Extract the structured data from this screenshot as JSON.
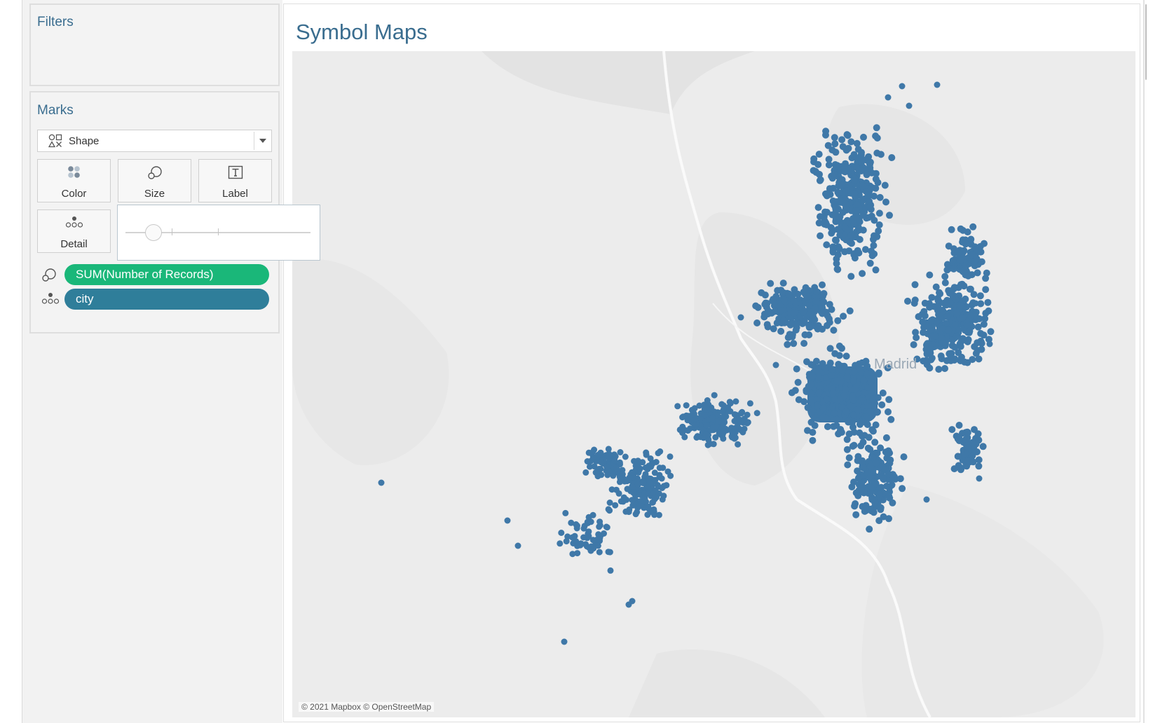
{
  "sidebar": {
    "filters_title": "Filters",
    "marks_title": "Marks",
    "mark_type": {
      "label": "Shape",
      "icon": "shape-icon"
    },
    "buttons": {
      "color": {
        "label": "Color",
        "icon": "color-dots-icon"
      },
      "size": {
        "label": "Size",
        "icon": "size-circles-icon"
      },
      "label": {
        "label": "Label",
        "icon": "text-label-icon"
      },
      "detail": {
        "label": "Detail",
        "icon": "detail-dots-icon"
      }
    },
    "size_slider": {
      "value": 0.15
    },
    "pills": [
      {
        "text": "SUM(Number of Records)",
        "icon": "size-circles-icon",
        "color": "#1ab779"
      },
      {
        "text": "city",
        "icon": "detail-dots-icon",
        "color": "#2f7e9a"
      }
    ]
  },
  "main": {
    "title": "Symbol Maps",
    "map": {
      "place_label": "Madrid",
      "attribution": "© 2021 Mapbox © OpenStreetMap",
      "mark_color": "#3f78a8",
      "background": "#ececec"
    }
  },
  "colors": {
    "title": "#3a6d8f",
    "pill_measure": "#1ab779",
    "pill_dimension": "#2f7e9a",
    "marks": "#3f78a8"
  }
}
